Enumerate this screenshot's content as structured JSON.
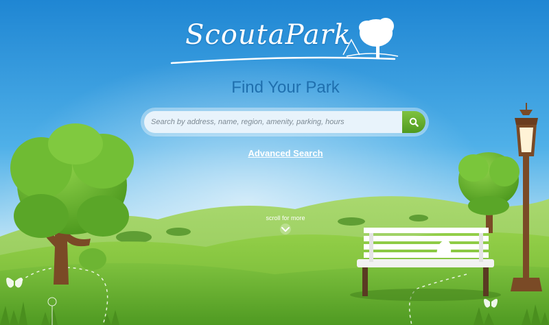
{
  "brand": {
    "name": "ScoutaPark",
    "logo_icon": "tree-swing-icon"
  },
  "hero": {
    "tagline": "Find Your Park"
  },
  "search": {
    "placeholder": "Search by address, name, region, amenity, parking, hours",
    "value": "",
    "button_icon": "search-icon"
  },
  "links": {
    "advanced_search": "Advanced Search"
  },
  "scroll": {
    "label": "scroll for more",
    "icon": "chevron-down-icon"
  },
  "colors": {
    "sky_top": "#2a8fd8",
    "sky_bottom": "#bfe4f6",
    "grass": "#7cc243",
    "search_button": "#5fa82a",
    "tagline": "#1f6fae"
  }
}
